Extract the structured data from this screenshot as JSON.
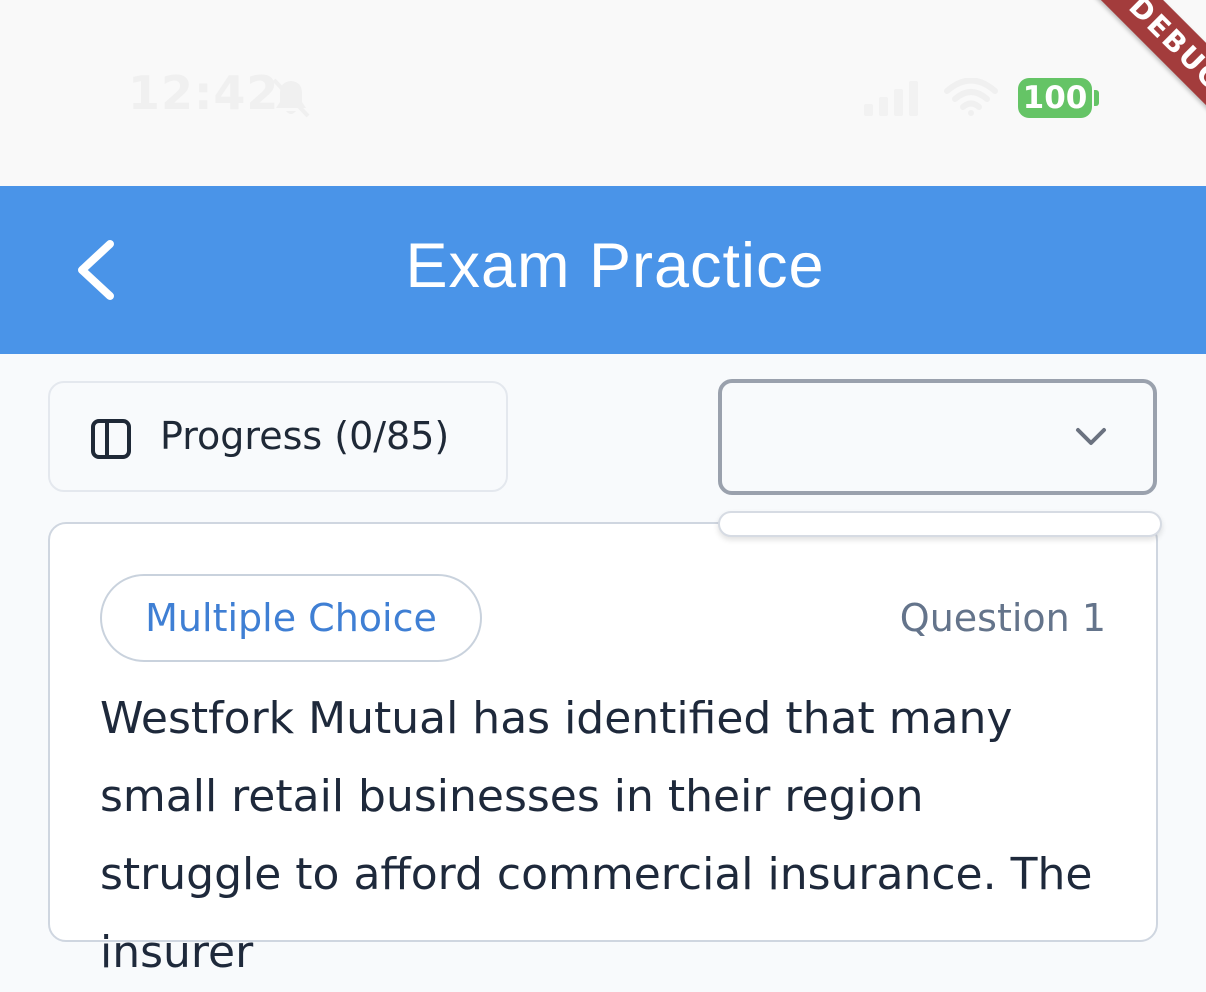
{
  "status_bar": {
    "time": "12:42",
    "battery": "100",
    "debug_banner": "DEBUG"
  },
  "app_bar": {
    "title": "Exam Practice"
  },
  "toolbar": {
    "progress_label": "Progress (0/85)",
    "select_value": ""
  },
  "question": {
    "type": "Multiple Choice",
    "number_label": "Question 1",
    "text": "Westfork Mutual has identified that many small retail businesses in their region struggle to afford commercial insurance. The insurer"
  },
  "colors": {
    "app_bar": "#4a94e8",
    "badge_text": "#3f7fd4",
    "battery": "#65c466",
    "debug": "#a33c3c"
  }
}
